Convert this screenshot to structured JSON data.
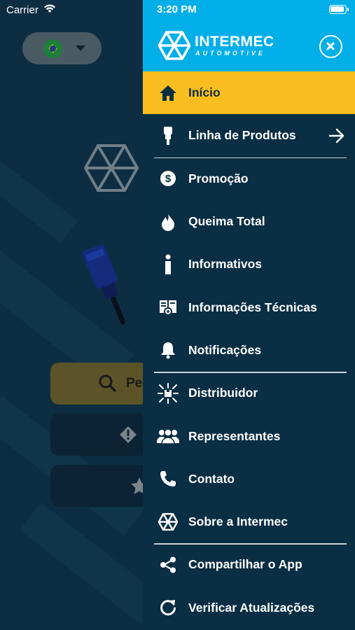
{
  "status_bar": {
    "carrier": "Carrier",
    "time": "3:20 PM"
  },
  "background": {
    "search_button_label": "Pe"
  },
  "drawer": {
    "brand_name": "INTERMEC",
    "brand_sub": "AUTOMOTIVE",
    "header_color": "#00aee8",
    "active_color": "#fbbe21",
    "items": [
      {
        "label": "Início",
        "icon": "home-icon",
        "active": true
      },
      {
        "label": "Linha de Produtos",
        "icon": "spark-plug-icon",
        "arrow": true
      },
      {
        "label": "Promoção",
        "icon": "dollar-coin-icon"
      },
      {
        "label": "Queima Total",
        "icon": "flame-icon"
      },
      {
        "label": "Informativos",
        "icon": "info-icon"
      },
      {
        "label": "Informações Técnicas",
        "icon": "technical-docs-icon"
      },
      {
        "label": "Notificações",
        "icon": "bell-icon"
      },
      {
        "label": "Distribuidor",
        "icon": "distribution-icon"
      },
      {
        "label": "Representantes",
        "icon": "people-icon"
      },
      {
        "label": "Contato",
        "icon": "phone-icon"
      },
      {
        "label": "Sobre a Intermec",
        "icon": "intermec-logo-icon"
      },
      {
        "label": "Compartilhar o App",
        "icon": "share-icon"
      },
      {
        "label": "Verificar Atualizações",
        "icon": "refresh-icon"
      }
    ]
  }
}
